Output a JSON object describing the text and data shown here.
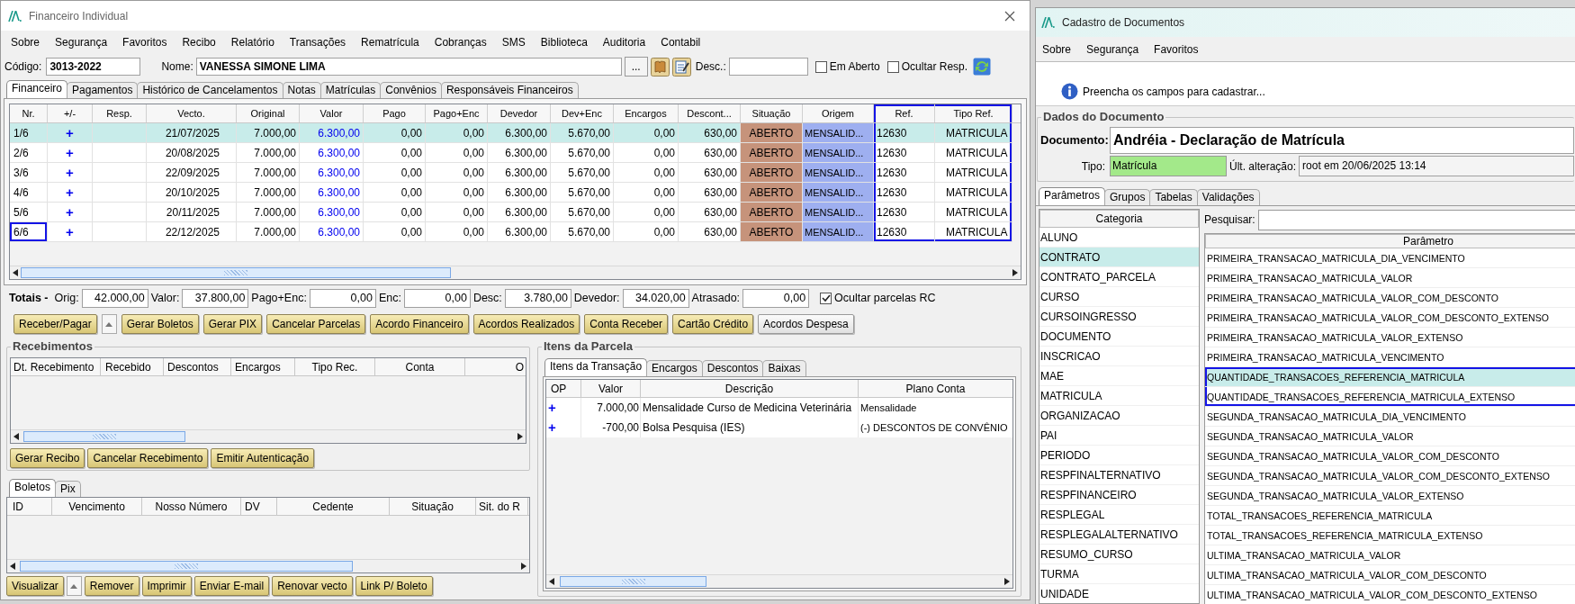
{
  "left_window": {
    "title": "Financeiro Individual",
    "menu": [
      "Sobre",
      "Segurança",
      "Favoritos",
      "Recibo",
      "Relatório",
      "Transações",
      "Rematrícula",
      "Cobranças",
      "SMS",
      "Biblioteca",
      "Auditoria",
      "Contabil"
    ],
    "codigo_label": "Código:",
    "codigo": "3013-2022",
    "nome_label": "Nome:",
    "nome": "VANESSA SIMONE LIMA",
    "more_button": "...",
    "desc_label": "Desc.:",
    "options": [
      {
        "label": "Em Aberto",
        "checked": false
      },
      {
        "label": "Ocultar Resp.",
        "checked": false
      }
    ],
    "tabs": [
      {
        "label": "Financeiro",
        "selected": true
      },
      {
        "label": "Pagamentos",
        "selected": false
      },
      {
        "label": "Histórico de Cancelamentos",
        "selected": false
      },
      {
        "label": "Notas",
        "selected": false
      },
      {
        "label": "Matrículas",
        "selected": false
      },
      {
        "label": "Convênios",
        "selected": false
      },
      {
        "label": "Responsáveis Financeiros",
        "selected": false
      }
    ],
    "table": {
      "columns": [
        {
          "label": "Nr.",
          "boxed": false
        },
        {
          "label": "+/-",
          "boxed": false
        },
        {
          "label": "Resp.",
          "boxed": false
        },
        {
          "label": "Vecto.",
          "boxed": false
        },
        {
          "label": "Original",
          "boxed": false
        },
        {
          "label": "Valor",
          "boxed": false
        },
        {
          "label": "Pago",
          "boxed": false
        },
        {
          "label": "Pago+Enc",
          "boxed": false
        },
        {
          "label": "Devedor",
          "boxed": false
        },
        {
          "label": "Dev+Enc",
          "boxed": false
        },
        {
          "label": "Encargos",
          "boxed": false
        },
        {
          "label": "Descont...",
          "boxed": false
        },
        {
          "label": "Situação",
          "boxed": false
        },
        {
          "label": "Origem",
          "boxed": false
        },
        {
          "label": "Ref.",
          "boxed": true
        },
        {
          "label": "Tipo Ref.",
          "boxed": true
        }
      ],
      "rows": [
        {
          "selected": true,
          "nr_boxed": false,
          "nr": "1/6",
          "op": "+",
          "vecto": "21/07/2025",
          "original": "7.000,00",
          "valor": "6.300,00",
          "pago": "0,00",
          "pago_enc": "0,00",
          "devedor": "6.300,00",
          "dev_enc": "5.670,00",
          "encargos": "0,00",
          "descontos": "630,00",
          "situacao": "ABERTO",
          "origem": "MENSALID...",
          "ref": "12630",
          "tipo_ref": "MATRICULA"
        },
        {
          "selected": false,
          "nr_boxed": false,
          "nr": "2/6",
          "op": "+",
          "vecto": "20/08/2025",
          "original": "7.000,00",
          "valor": "6.300,00",
          "pago": "0,00",
          "pago_enc": "0,00",
          "devedor": "6.300,00",
          "dev_enc": "5.670,00",
          "encargos": "0,00",
          "descontos": "630,00",
          "situacao": "ABERTO",
          "origem": "MENSALID...",
          "ref": "12630",
          "tipo_ref": "MATRICULA"
        },
        {
          "selected": false,
          "nr_boxed": false,
          "nr": "3/6",
          "op": "+",
          "vecto": "22/09/2025",
          "original": "7.000,00",
          "valor": "6.300,00",
          "pago": "0,00",
          "pago_enc": "0,00",
          "devedor": "6.300,00",
          "dev_enc": "5.670,00",
          "encargos": "0,00",
          "descontos": "630,00",
          "situacao": "ABERTO",
          "origem": "MENSALID...",
          "ref": "12630",
          "tipo_ref": "MATRICULA"
        },
        {
          "selected": false,
          "nr_boxed": false,
          "nr": "4/6",
          "op": "+",
          "vecto": "20/10/2025",
          "original": "7.000,00",
          "valor": "6.300,00",
          "pago": "0,00",
          "pago_enc": "0,00",
          "devedor": "6.300,00",
          "dev_enc": "5.670,00",
          "encargos": "0,00",
          "descontos": "630,00",
          "situacao": "ABERTO",
          "origem": "MENSALID...",
          "ref": "12630",
          "tipo_ref": "MATRICULA"
        },
        {
          "selected": false,
          "nr_boxed": false,
          "nr": "5/6",
          "op": "+",
          "vecto": "20/11/2025",
          "original": "7.000,00",
          "valor": "6.300,00",
          "pago": "0,00",
          "pago_enc": "0,00",
          "devedor": "6.300,00",
          "dev_enc": "5.670,00",
          "encargos": "0,00",
          "descontos": "630,00",
          "situacao": "ABERTO",
          "origem": "MENSALID...",
          "ref": "12630",
          "tipo_ref": "MATRICULA"
        },
        {
          "selected": false,
          "nr_boxed": true,
          "nr": "6/6",
          "op": "+",
          "vecto": "22/12/2025",
          "original": "7.000,00",
          "valor": "6.300,00",
          "pago": "0,00",
          "pago_enc": "0,00",
          "devedor": "6.300,00",
          "dev_enc": "5.670,00",
          "encargos": "0,00",
          "descontos": "630,00",
          "situacao": "ABERTO",
          "origem": "MENSALID...",
          "ref": "12630",
          "tipo_ref": "MATRICULA"
        }
      ]
    },
    "totals_label": "Totais -",
    "totals": [
      {
        "label": "Orig:",
        "value": "42.000,00"
      },
      {
        "label": "Valor:",
        "value": "37.800,00"
      },
      {
        "label": "Pago+Enc:",
        "value": "0,00"
      },
      {
        "label": "Enc:",
        "value": "0,00"
      },
      {
        "label": "Desc:",
        "value": "3.780,00"
      },
      {
        "label": "Devedor:",
        "value": "34.020,00"
      },
      {
        "label": "Atrasado:",
        "value": "0,00"
      }
    ],
    "hide_rc": {
      "label": "Ocultar parcelas RC",
      "checked": true
    },
    "actions": [
      {
        "label": "Receber/Pagar",
        "kind": "yellow"
      },
      {
        "label": "Gerar Boletos",
        "kind": "yellow"
      },
      {
        "label": "Gerar PIX",
        "kind": "yellow"
      },
      {
        "label": "Cancelar Parcelas",
        "kind": "yellow"
      },
      {
        "label": "Acordo Financeiro",
        "kind": "yellow"
      },
      {
        "label": "Acordos Realizados",
        "kind": "yellow"
      },
      {
        "label": "Conta Receber",
        "kind": "yellow"
      },
      {
        "label": "Cartão Crédito",
        "kind": "yellow"
      },
      {
        "label": "Acordos Despesa",
        "kind": "plain"
      }
    ],
    "recebimentos": {
      "title": "Recebimentos",
      "columns": [
        "Dt. Recebimento",
        "Recebido",
        "Descontos",
        "Encargos",
        "Tipo Rec.",
        "Conta",
        "O"
      ],
      "buttons": [
        "Gerar Recibo",
        "Cancelar Recebimento",
        "Emitir Autenticação"
      ]
    },
    "boletos": {
      "tabs": [
        {
          "label": "Boletos",
          "selected": true
        },
        {
          "label": "Pix",
          "selected": false
        }
      ],
      "columns": [
        "ID",
        "Vencimento",
        "Nosso Número",
        "DV",
        "Cedente",
        "Situação",
        "Sit. do R"
      ],
      "buttons": [
        "Visualizar",
        "Remover",
        "Imprimir",
        "Enviar E-mail",
        "Renovar vecto",
        "Link P/ Boleto"
      ]
    },
    "itens_parcela": {
      "title": "Itens da Parcela",
      "tabs": [
        {
          "label": "Itens da Transação",
          "selected": true
        },
        {
          "label": "Encargos",
          "selected": false
        },
        {
          "label": "Descontos",
          "selected": false
        },
        {
          "label": "Baixas",
          "selected": false
        }
      ],
      "columns": [
        "OP",
        "Valor",
        "Descrição",
        "Plano Conta"
      ],
      "rows": [
        {
          "op": "+",
          "valor": "7.000,00",
          "descricao": "Mensalidade Curso de Medicina Veterinária",
          "plano_conta": "Mensalidade"
        },
        {
          "op": "+",
          "valor": "-700,00",
          "descricao": "Bolsa Pesquisa (IES)",
          "plano_conta": "(-) DESCONTOS DE CONVÊNIO"
        }
      ]
    }
  },
  "right_window": {
    "title": "Cadastro de Documentos",
    "menu": [
      "Sobre",
      "Segurança",
      "Favoritos"
    ],
    "info": "Preencha os campos para cadastrar...",
    "group_title": "Dados do Documento",
    "documento_label": "Documento:",
    "documento": "Andréia - Declaração de Matrícula",
    "tipo_label": "Tipo:",
    "tipo": "Matrícula",
    "alteracao_label": "Últ. alteração:",
    "alteracao": "root em 20/06/2025 13:14",
    "tabs": [
      {
        "label": "Parâmetros",
        "selected": true
      },
      {
        "label": "Grupos",
        "selected": false
      },
      {
        "label": "Tabelas",
        "selected": false
      },
      {
        "label": "Validações",
        "selected": false
      }
    ],
    "categoria_header": "Categoria",
    "categories": [
      {
        "label": "ALUNO",
        "selected": false
      },
      {
        "label": "CONTRATO",
        "selected": true
      },
      {
        "label": "CONTRATO_PARCELA",
        "selected": false
      },
      {
        "label": "CURSO",
        "selected": false
      },
      {
        "label": "CURSOINGRESSO",
        "selected": false
      },
      {
        "label": "DOCUMENTO",
        "selected": false
      },
      {
        "label": "INSCRICAO",
        "selected": false
      },
      {
        "label": "MAE",
        "selected": false
      },
      {
        "label": "MATRICULA",
        "selected": false
      },
      {
        "label": "ORGANIZACAO",
        "selected": false
      },
      {
        "label": "PAI",
        "selected": false
      },
      {
        "label": "PERIODO",
        "selected": false
      },
      {
        "label": "RESPFINALTERNATIVO",
        "selected": false
      },
      {
        "label": "RESPFINANCEIRO",
        "selected": false
      },
      {
        "label": "RESPLEGAL",
        "selected": false
      },
      {
        "label": "RESPLEGALALTERNATIVO",
        "selected": false
      },
      {
        "label": "RESUMO_CURSO",
        "selected": false
      },
      {
        "label": "TURMA",
        "selected": false
      },
      {
        "label": "UNIDADE",
        "selected": false
      }
    ],
    "search_label": "Pesquisar:",
    "parametro_header": "Parâmetro",
    "parameters": [
      {
        "label": "PRIMEIRA_TRANSACAO_MATRICULA_DIA_VENCIMENTO",
        "selected": false,
        "boxed": false
      },
      {
        "label": "PRIMEIRA_TRANSACAO_MATRICULA_VALOR",
        "selected": false,
        "boxed": false
      },
      {
        "label": "PRIMEIRA_TRANSACAO_MATRICULA_VALOR_COM_DESCONTO",
        "selected": false,
        "boxed": false
      },
      {
        "label": "PRIMEIRA_TRANSACAO_MATRICULA_VALOR_COM_DESCONTO_EXTENSO",
        "selected": false,
        "boxed": false
      },
      {
        "label": "PRIMEIRA_TRANSACAO_MATRICULA_VALOR_EXTENSO",
        "selected": false,
        "boxed": false
      },
      {
        "label": "PRIMEIRA_TRANSACAO_MATRICULA_VENCIMENTO",
        "selected": false,
        "boxed": false
      },
      {
        "label": "QUANTIDADE_TRANSACOES_REFERENCIA_MATRICULA",
        "selected": true,
        "boxed": true
      },
      {
        "label": "QUANTIDADE_TRANSACOES_REFERENCIA_MATRICULA_EXTENSO",
        "selected": false,
        "boxed": true
      },
      {
        "label": "SEGUNDA_TRANSACAO_MATRICULA_DIA_VENCIMENTO",
        "selected": false,
        "boxed": false
      },
      {
        "label": "SEGUNDA_TRANSACAO_MATRICULA_VALOR",
        "selected": false,
        "boxed": false
      },
      {
        "label": "SEGUNDA_TRANSACAO_MATRICULA_VALOR_COM_DESCONTO",
        "selected": false,
        "boxed": false
      },
      {
        "label": "SEGUNDA_TRANSACAO_MATRICULA_VALOR_COM_DESCONTO_EXTENSO",
        "selected": false,
        "boxed": false
      },
      {
        "label": "SEGUNDA_TRANSACAO_MATRICULA_VALOR_EXTENSO",
        "selected": false,
        "boxed": false
      },
      {
        "label": "TOTAL_TRANSACOES_REFERENCIA_MATRICULA",
        "selected": false,
        "boxed": false
      },
      {
        "label": "TOTAL_TRANSACOES_REFERENCIA_MATRICULA_EXTENSO",
        "selected": false,
        "boxed": false
      },
      {
        "label": "ULTIMA_TRANSACAO_MATRICULA_VALOR",
        "selected": false,
        "boxed": false
      },
      {
        "label": "ULTIMA_TRANSACAO_MATRICULA_VALOR_COM_DESCONTO",
        "selected": false,
        "boxed": false
      },
      {
        "label": "ULTIMA_TRANSACAO_MATRICULA_VALOR_COM_DESCONTO_EXTENSO",
        "selected": false,
        "boxed": false
      }
    ]
  }
}
